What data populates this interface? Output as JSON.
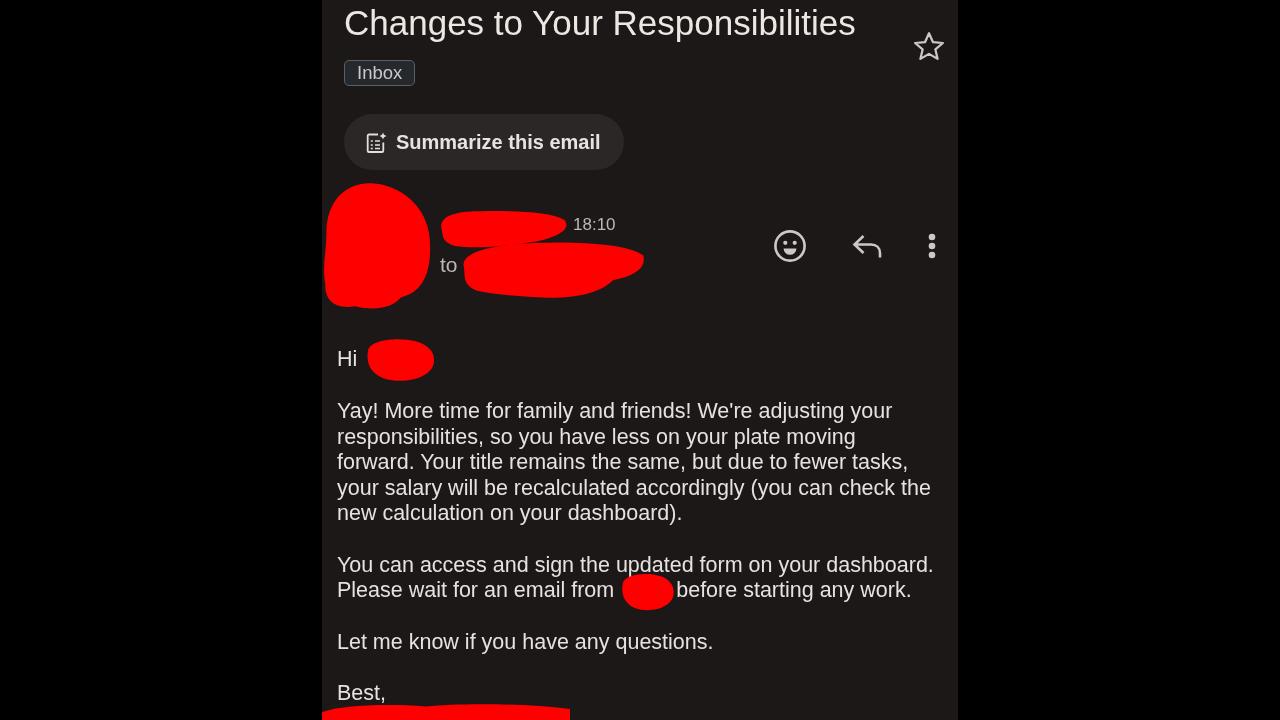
{
  "email": {
    "subject": "Changes to Your Responsibilities",
    "starred": false,
    "labels": [
      "Inbox"
    ]
  },
  "summarize_button": {
    "label": "Summarize this email"
  },
  "sender": {
    "time": "18:10",
    "recipient_prefix": "to"
  },
  "body": [
    {
      "segments": [
        {
          "kind": "text",
          "text": "Hi"
        },
        {
          "kind": "redaction"
        }
      ]
    },
    {
      "segments": [
        {
          "kind": "text",
          "text": "Yay! More time for family and friends! We're adjusting your responsibilities, so you have less on your plate moving forward. Your title remains the same, but due to fewer tasks, your salary will be recalculated accordingly (you can check the new calculation on your dashboard)."
        }
      ]
    },
    {
      "segments": [
        {
          "kind": "text",
          "text": "You can access and sign the updated form on your dashboard."
        },
        {
          "kind": "text",
          "text": "Please wait for an email from"
        },
        {
          "kind": "redaction"
        },
        {
          "kind": "text",
          "text": "before starting any work."
        }
      ]
    },
    {
      "segments": [
        {
          "kind": "text",
          "text": "Let me know if you have any questions."
        }
      ]
    },
    {
      "segments": [
        {
          "kind": "text",
          "text": "Best,"
        }
      ]
    },
    {
      "segments": [
        {
          "kind": "redaction"
        }
      ]
    }
  ]
}
